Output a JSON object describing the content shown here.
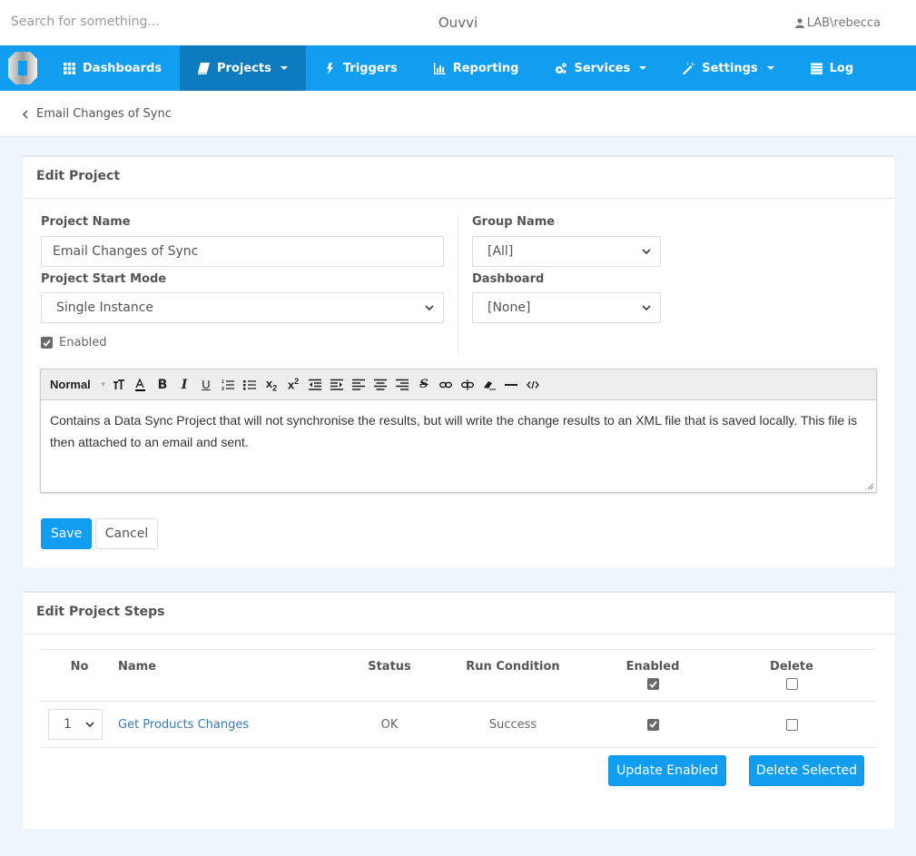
{
  "topbar": {
    "search_placeholder": "Search for something...",
    "app_title": "Ouvvi",
    "user": "LAB\\rebecca"
  },
  "nav": {
    "items": [
      {
        "label": "Dashboards",
        "icon": "grid-icon",
        "active": false,
        "dropdown": false
      },
      {
        "label": "Projects",
        "icon": "book-icon",
        "active": true,
        "dropdown": true
      },
      {
        "label": "Triggers",
        "icon": "bolt-icon",
        "active": false,
        "dropdown": false
      },
      {
        "label": "Reporting",
        "icon": "bar-chart-icon",
        "active": false,
        "dropdown": false
      },
      {
        "label": "Services",
        "icon": "cogs-icon",
        "active": false,
        "dropdown": true
      },
      {
        "label": "Settings",
        "icon": "magic-wand-icon",
        "active": false,
        "dropdown": true
      },
      {
        "label": "Log",
        "icon": "list-icon",
        "active": false,
        "dropdown": false
      }
    ],
    "accent": "#119df0",
    "active_bg": "#0f7bbf"
  },
  "breadcrumb": {
    "back_label": "Email Changes of Sync"
  },
  "edit_project": {
    "title": "Edit Project",
    "project_name_label": "Project Name",
    "project_name_value": "Email Changes of Sync",
    "start_mode_label": "Project Start Mode",
    "start_mode_value": "Single Instance",
    "enabled_label": "Enabled",
    "enabled_checked": true,
    "group_name_label": "Group Name",
    "group_name_value": "[All]",
    "dashboard_label": "Dashboard",
    "dashboard_value": "[None]",
    "editor": {
      "format_value": "Normal",
      "toolbar_buttons": [
        "font-size",
        "font-color",
        "bold",
        "italic",
        "underline",
        "ordered-list",
        "unordered-list",
        "subscript",
        "superscript",
        "outdent",
        "indent",
        "align-left",
        "align-center",
        "align-right",
        "strikethrough",
        "link",
        "unlink",
        "clear-format",
        "horizontal-rule",
        "code-view"
      ],
      "content": "Contains a Data Sync Project that will not synchronise the results, but will write the change results to an XML file that is saved locally. This file is then attached to an email and sent."
    },
    "save_label": "Save",
    "cancel_label": "Cancel"
  },
  "edit_steps": {
    "title": "Edit Project Steps",
    "columns": {
      "no": "No",
      "name": "Name",
      "status": "Status",
      "run_condition": "Run Condition",
      "enabled": "Enabled",
      "delete": "Delete"
    },
    "header_enabled_checked": true,
    "header_delete_checked": false,
    "rows": [
      {
        "no": "1",
        "name": "Get Products Changes",
        "status": "OK",
        "run_condition": "Success",
        "enabled": true,
        "delete": false
      }
    ],
    "update_enabled_label": "Update Enabled",
    "delete_selected_label": "Delete Selected"
  }
}
